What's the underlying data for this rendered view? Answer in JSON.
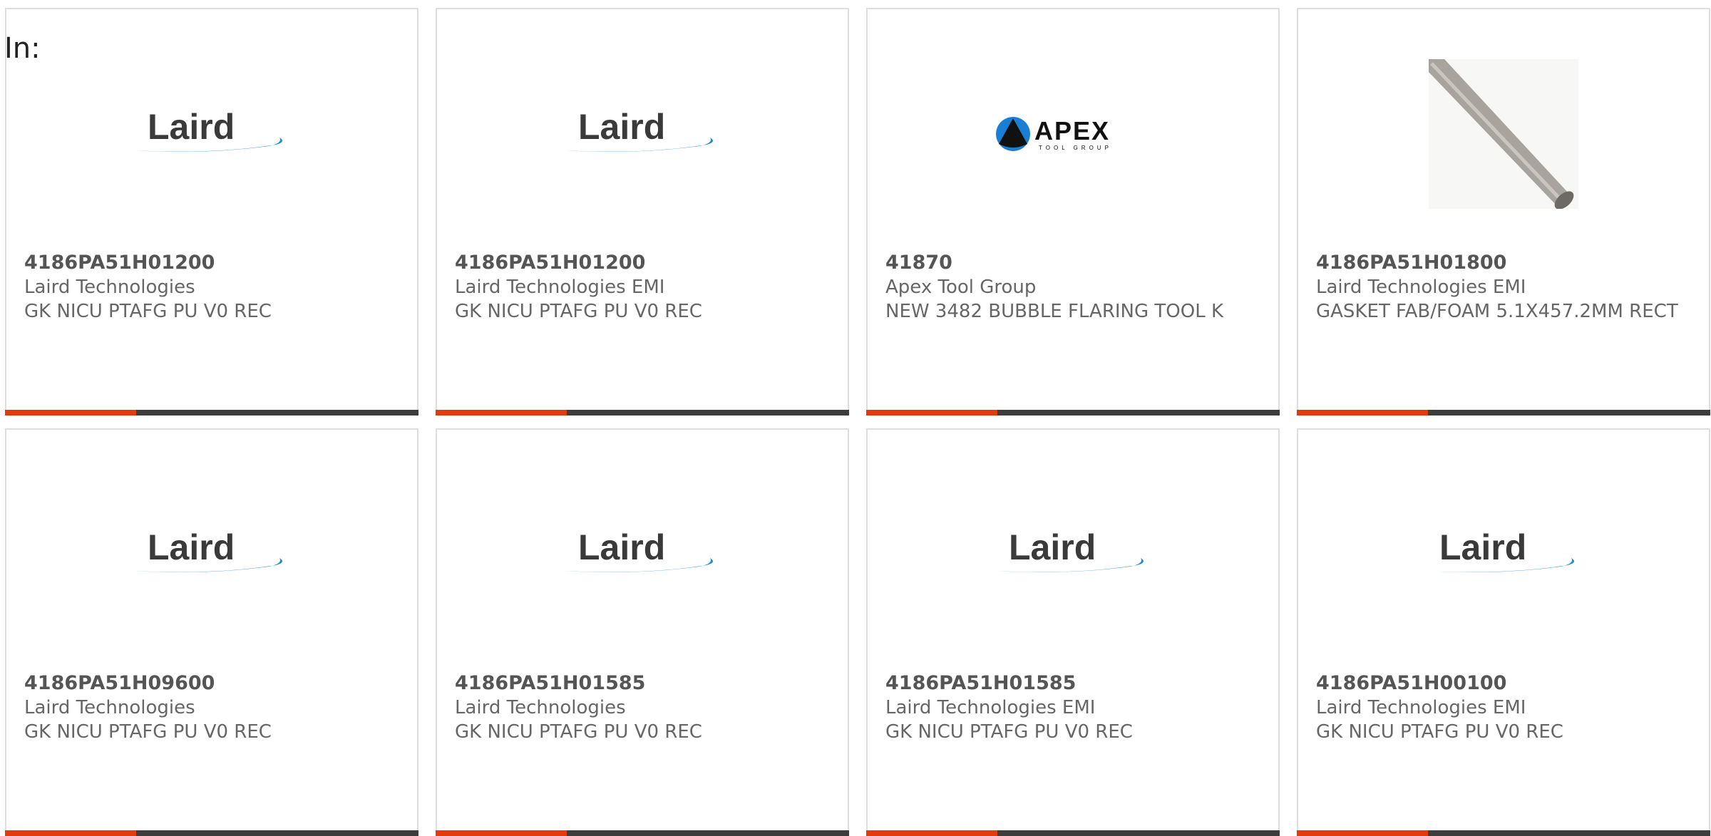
{
  "page": {
    "in_label": "In:"
  },
  "colors": {
    "accent": "#e23b0e",
    "bar": "#3d3d3d",
    "laird_blue": "#1e8ccf"
  },
  "products": [
    {
      "part_number": "4186PA51H01200",
      "manufacturer": "Laird Technologies",
      "description": "GK NICU PTAFG PU V0 REC",
      "image": "laird-logo",
      "logo_text": "Laird"
    },
    {
      "part_number": "4186PA51H01200",
      "manufacturer": "Laird Technologies EMI",
      "description": "GK NICU PTAFG PU V0 REC",
      "image": "laird-logo",
      "logo_text": "Laird"
    },
    {
      "part_number": "41870",
      "manufacturer": "Apex Tool Group",
      "description": "NEW 3482 BUBBLE FLARING TOOL K",
      "image": "apex-logo",
      "logo_text": "APEX",
      "logo_subtext": "TOOL GROUP"
    },
    {
      "part_number": "4186PA51H01800",
      "manufacturer": "Laird Technologies EMI",
      "description": "GASKET FAB/FOAM 5.1X457.2MM RECT",
      "image": "gasket-photo"
    },
    {
      "part_number": "4186PA51H09600",
      "manufacturer": "Laird Technologies",
      "description": "GK NICU PTAFG PU V0 REC",
      "image": "laird-logo",
      "logo_text": "Laird"
    },
    {
      "part_number": "4186PA51H01585",
      "manufacturer": "Laird Technologies",
      "description": "GK NICU PTAFG PU V0 REC",
      "image": "laird-logo",
      "logo_text": "Laird"
    },
    {
      "part_number": "4186PA51H01585",
      "manufacturer": "Laird Technologies EMI",
      "description": "GK NICU PTAFG PU V0 REC",
      "image": "laird-logo",
      "logo_text": "Laird"
    },
    {
      "part_number": "4186PA51H00100",
      "manufacturer": "Laird Technologies EMI",
      "description": "GK NICU PTAFG PU V0 REC",
      "image": "laird-logo",
      "logo_text": "Laird"
    }
  ]
}
